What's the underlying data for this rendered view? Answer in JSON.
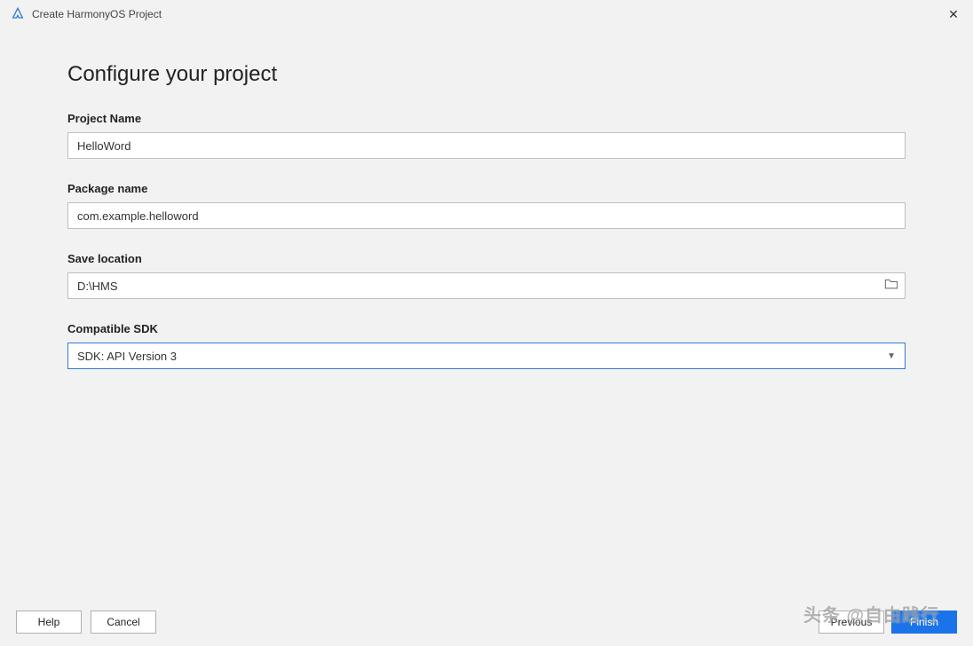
{
  "window": {
    "title": "Create HarmonyOS Project"
  },
  "heading": "Configure your project",
  "form": {
    "projectName": {
      "label": "Project Name",
      "value": "HelloWord"
    },
    "packageName": {
      "label": "Package name",
      "value": "com.example.helloword"
    },
    "saveLocation": {
      "label": "Save location",
      "value": "D:\\HMS"
    },
    "compatibleSdk": {
      "label": "Compatible SDK",
      "value": "SDK: API Version 3"
    }
  },
  "footer": {
    "help": "Help",
    "cancel": "Cancel",
    "previous": "Previous",
    "finish": "Finish"
  },
  "watermark": "头条 @自由践行"
}
